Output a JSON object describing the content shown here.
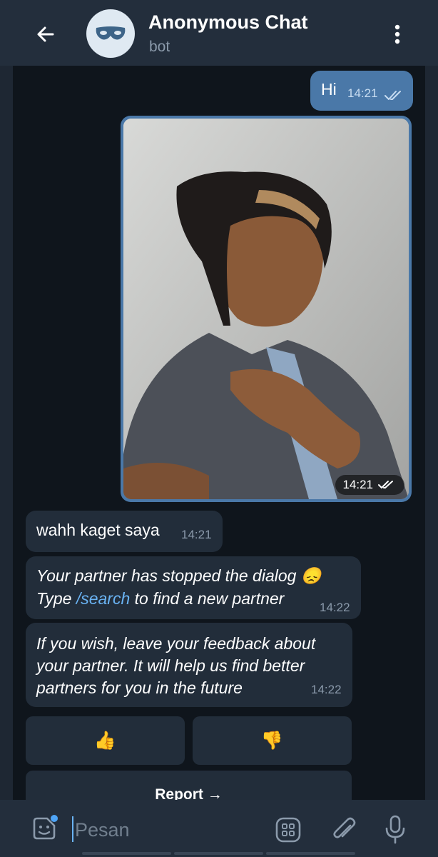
{
  "header": {
    "title": "Anonymous Chat",
    "subtitle": "bot"
  },
  "messages": {
    "outgoing_text": {
      "text": "Hi",
      "time": "14:21"
    },
    "outgoing_photo": {
      "time": "14:21"
    },
    "incoming_1": {
      "text": "wahh kaget saya",
      "time": "14:21"
    },
    "incoming_2": {
      "line1": "Your partner has stopped the dialog",
      "emoji": "😞",
      "line2_prefix": "Type ",
      "command": "/search",
      "line2_suffix": " to find a new partner",
      "time": "14:22"
    },
    "incoming_3": {
      "line1": "If you wish, leave your feedback about",
      "line2": "your partner. It will help us find better",
      "line3": "partners for you in the future",
      "time": "14:22"
    }
  },
  "keyboard": {
    "like": "👍",
    "dislike": "👎",
    "report": "Report →"
  },
  "input": {
    "placeholder": "Pesan"
  },
  "colors": {
    "header_bg": "#232e3c",
    "chat_bg": "#0f151c",
    "outgoing_bubble": "#4a78a8",
    "incoming_bubble": "#222d3a",
    "link": "#6ab3f3"
  },
  "icons": [
    "arrow-left-icon",
    "mask-icon",
    "more-vertical-icon",
    "double-check-icon",
    "sticker-icon",
    "bot-commands-icon",
    "paperclip-icon",
    "microphone-icon"
  ]
}
